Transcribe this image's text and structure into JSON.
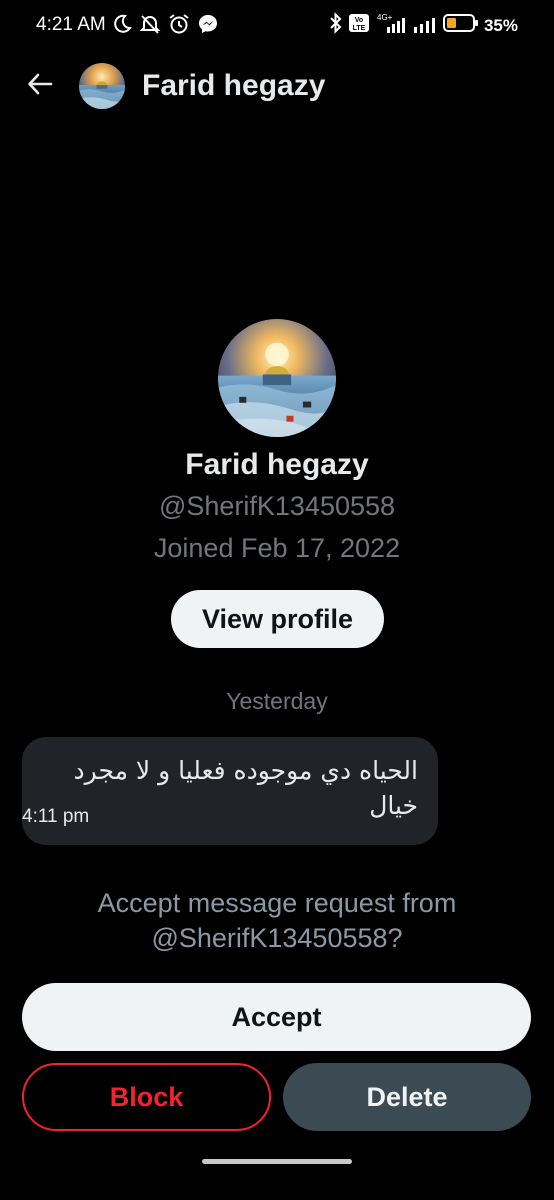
{
  "status_bar": {
    "time": "4:21 AM",
    "battery_percent": "35%",
    "network_label": "4G+",
    "volte_label": "Vo LTE",
    "icons": [
      "moon-icon",
      "mute-icon",
      "alarm-icon",
      "messenger-icon",
      "bluetooth-icon",
      "signal-icon",
      "signal-icon-2",
      "battery-icon"
    ]
  },
  "header": {
    "name": "Farid hegazy",
    "back_icon": "arrow-left-icon"
  },
  "profile": {
    "name": "Farid hegazy",
    "handle": "@SherifK13450558",
    "joined": "Joined Feb 17, 2022",
    "view_profile_label": "View profile"
  },
  "conversation": {
    "date_divider": "Yesterday",
    "message": {
      "text": "الحياه دي موجوده فعليا و لا مجرد خيال",
      "time": "4:11 pm"
    }
  },
  "request": {
    "prompt": "Accept message request from @SherifK13450558?",
    "accept_label": "Accept",
    "block_label": "Block",
    "delete_label": "Delete"
  },
  "colors": {
    "background": "#000000",
    "primary_text": "#e7e9ea",
    "secondary_text": "#71767b",
    "danger": "#f4212e",
    "bubble": "#202327",
    "delete_button": "#3c4a54"
  }
}
